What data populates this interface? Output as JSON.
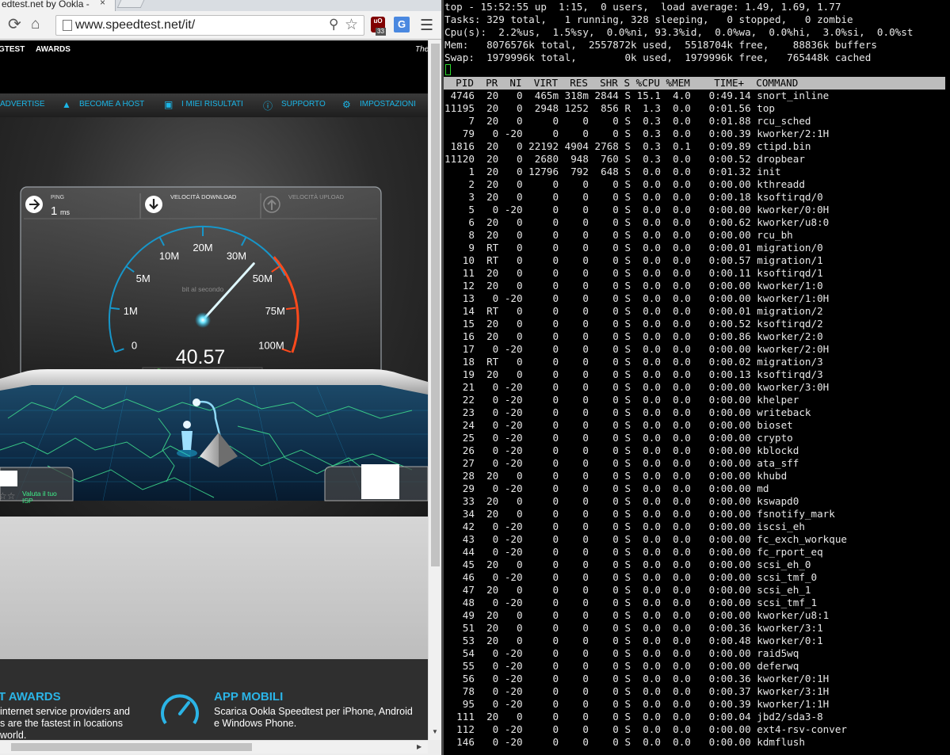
{
  "browser": {
    "tab_title": "edtest.net by Ookla -",
    "tab_close": "×",
    "url": "www.speedtest.net/it/",
    "ublock_label": "uO",
    "ublock_count": "33",
    "gtrans_label": "G"
  },
  "speedtest": {
    "header_left": "GTEST",
    "header_awards": "AWARDS",
    "header_right": "The",
    "nav": [
      "ADVERTISE",
      "BECOME A HOST",
      "I MIEI RISULTATI",
      "SUPPORTO",
      "IMPOSTAZIONI"
    ],
    "ping_label": "PING",
    "ping_value": "1",
    "ping_unit": "ms",
    "download_label": "VELOCITÀ DOWNLOAD",
    "upload_label": "VELOCITÀ UPLOAD",
    "unit_label": "bit al secondo",
    "speed_value": "40.57",
    "speed_numeric": 40.57,
    "gauge_ticks": [
      "0",
      "1M",
      "5M",
      "10M",
      "20M",
      "30M",
      "50M",
      "75M",
      "100M"
    ],
    "rate_isp_line1": "Valuta il tuo",
    "rate_isp_line2": "ISP",
    "footer": {
      "awards_title": "T AWARDS",
      "awards_text1": "internet service providers and",
      "awards_text2": "s are the fastest in locations",
      "awards_text3": "world.",
      "mobile_title": "APP MOBILI",
      "mobile_text1": "Scarica Ookla Speedtest per iPhone, Android",
      "mobile_text2": "e Windows Phone."
    }
  },
  "terminal": {
    "summary": [
      "top - 15:52:55 up  1:15,  0 users,  load average: 1.49, 1.69, 1.77",
      "Tasks: 329 total,   1 running, 328 sleeping,   0 stopped,   0 zombie",
      "Cpu(s):  2.2%us,  1.5%sy,  0.0%ni, 93.3%id,  0.0%wa,  0.0%hi,  3.0%si,  0.0%st",
      "Mem:   8076576k total,  2557872k used,  5518704k free,    88836k buffers",
      "Swap:  1979996k total,        0k used,  1979996k free,   765448k cached"
    ],
    "header": "  PID  PR  NI  VIRT  RES  SHR S %CPU %MEM    TIME+  COMMAND",
    "processes": [
      " 4746  20   0  465m 318m 2844 S 15.1  4.0   0:49.14 snort_inline",
      "11195  20   0  2948 1252  856 R  1.3  0.0   0:01.56 top",
      "    7  20   0     0    0    0 S  0.3  0.0   0:01.88 rcu_sched",
      "   79   0 -20     0    0    0 S  0.3  0.0   0:00.39 kworker/2:1H",
      " 1816  20   0 22192 4904 2768 S  0.3  0.1   0:09.89 ctipd.bin",
      "11120  20   0  2680  948  760 S  0.3  0.0   0:00.52 dropbear",
      "    1  20   0 12796  792  648 S  0.0  0.0   0:01.32 init",
      "    2  20   0     0    0    0 S  0.0  0.0   0:00.00 kthreadd",
      "    3  20   0     0    0    0 S  0.0  0.0   0:00.18 ksoftirqd/0",
      "    5   0 -20     0    0    0 S  0.0  0.0   0:00.00 kworker/0:0H",
      "    6  20   0     0    0    0 S  0.0  0.0   0:00.62 kworker/u8:0",
      "    8  20   0     0    0    0 S  0.0  0.0   0:00.00 rcu_bh",
      "    9  RT   0     0    0    0 S  0.0  0.0   0:00.01 migration/0",
      "   10  RT   0     0    0    0 S  0.0  0.0   0:00.57 migration/1",
      "   11  20   0     0    0    0 S  0.0  0.0   0:00.11 ksoftirqd/1",
      "   12  20   0     0    0    0 S  0.0  0.0   0:00.00 kworker/1:0",
      "   13   0 -20     0    0    0 S  0.0  0.0   0:00.00 kworker/1:0H",
      "   14  RT   0     0    0    0 S  0.0  0.0   0:00.01 migration/2",
      "   15  20   0     0    0    0 S  0.0  0.0   0:00.52 ksoftirqd/2",
      "   16  20   0     0    0    0 S  0.0  0.0   0:00.86 kworker/2:0",
      "   17   0 -20     0    0    0 S  0.0  0.0   0:00.00 kworker/2:0H",
      "   18  RT   0     0    0    0 S  0.0  0.0   0:00.02 migration/3",
      "   19  20   0     0    0    0 S  0.0  0.0   0:00.13 ksoftirqd/3",
      "   21   0 -20     0    0    0 S  0.0  0.0   0:00.00 kworker/3:0H",
      "   22   0 -20     0    0    0 S  0.0  0.0   0:00.00 khelper",
      "   23   0 -20     0    0    0 S  0.0  0.0   0:00.00 writeback",
      "   24   0 -20     0    0    0 S  0.0  0.0   0:00.00 bioset",
      "   25   0 -20     0    0    0 S  0.0  0.0   0:00.00 crypto",
      "   26   0 -20     0    0    0 S  0.0  0.0   0:00.00 kblockd",
      "   27   0 -20     0    0    0 S  0.0  0.0   0:00.00 ata_sff",
      "   28  20   0     0    0    0 S  0.0  0.0   0:00.00 khubd",
      "   29   0 -20     0    0    0 S  0.0  0.0   0:00.00 md",
      "   33  20   0     0    0    0 S  0.0  0.0   0:00.00 kswapd0",
      "   34  20   0     0    0    0 S  0.0  0.0   0:00.00 fsnotify_mark",
      "   42   0 -20     0    0    0 S  0.0  0.0   0:00.00 iscsi_eh",
      "   43   0 -20     0    0    0 S  0.0  0.0   0:00.00 fc_exch_workque",
      "   44   0 -20     0    0    0 S  0.0  0.0   0:00.00 fc_rport_eq",
      "   45  20   0     0    0    0 S  0.0  0.0   0:00.00 scsi_eh_0",
      "   46   0 -20     0    0    0 S  0.0  0.0   0:00.00 scsi_tmf_0",
      "   47  20   0     0    0    0 S  0.0  0.0   0:00.00 scsi_eh_1",
      "   48   0 -20     0    0    0 S  0.0  0.0   0:00.00 scsi_tmf_1",
      "   49  20   0     0    0    0 S  0.0  0.0   0:00.00 kworker/u8:1",
      "   51  20   0     0    0    0 S  0.0  0.0   0:00.36 kworker/3:1",
      "   53  20   0     0    0    0 S  0.0  0.0   0:00.48 kworker/0:1",
      "   54   0 -20     0    0    0 S  0.0  0.0   0:00.00 raid5wq",
      "   55   0 -20     0    0    0 S  0.0  0.0   0:00.00 deferwq",
      "   56   0 -20     0    0    0 S  0.0  0.0   0:00.36 kworker/0:1H",
      "   78   0 -20     0    0    0 S  0.0  0.0   0:00.37 kworker/3:1H",
      "   95   0 -20     0    0    0 S  0.0  0.0   0:00.39 kworker/1:1H",
      "  111  20   0     0    0    0 S  0.0  0.0   0:00.04 jbd2/sda3-8",
      "  112   0 -20     0    0    0 S  0.0  0.0   0:00.00 ext4-rsv-conver",
      "  146   0 -20     0    0    0 S  0.0  0.0   0:00.00 kdmflush"
    ]
  }
}
